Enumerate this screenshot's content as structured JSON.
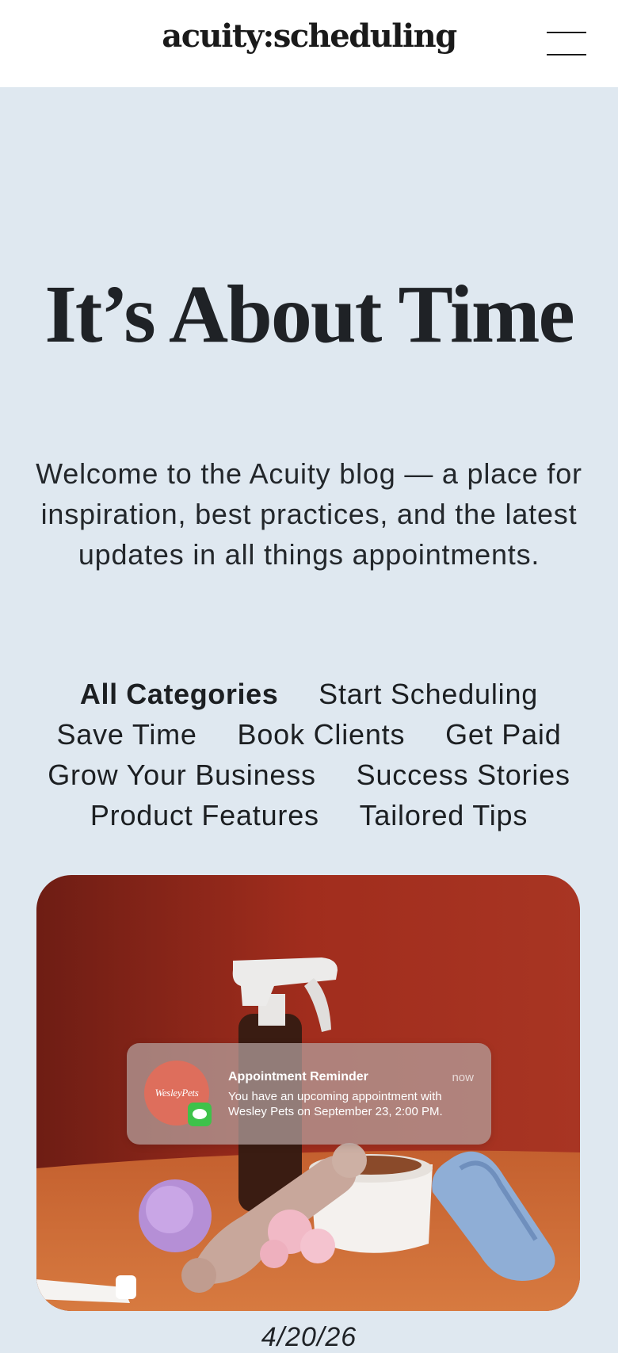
{
  "header": {
    "logo_text": "acuity:scheduling",
    "menu_icon": "hamburger-menu-icon"
  },
  "hero": {
    "title": "It’s About Time",
    "intro": "Welcome to the Acuity blog — a place for inspiration, best practices, and the latest updates in all things appointments."
  },
  "categories": [
    {
      "label": "All Categories",
      "active": true
    },
    {
      "label": "Start Scheduling",
      "active": false
    },
    {
      "label": "Save Time",
      "active": false
    },
    {
      "label": "Book Clients",
      "active": false
    },
    {
      "label": "Get Paid",
      "active": false
    },
    {
      "label": "Grow Your Business",
      "active": false
    },
    {
      "label": "Success Stories",
      "active": false
    },
    {
      "label": "Product Features",
      "active": false
    },
    {
      "label": "Tailored Tips",
      "active": false
    }
  ],
  "featured_post": {
    "image_alt_icon": "pet-supplies-photo",
    "notification": {
      "avatar_text": "WesleyPets",
      "app_icon": "messages-icon",
      "title": "Appointment Reminder",
      "time": "now",
      "body": "You have an upcoming appointment with Wesley Pets on September 23, 2:00 PM."
    },
    "date": "4/20/26"
  },
  "colors": {
    "page_background": "#dfe8f0",
    "header_background": "#ffffff",
    "text": "#1f2226",
    "photo_backdrop": "#a7301f",
    "avatar": "#de6e5c"
  }
}
